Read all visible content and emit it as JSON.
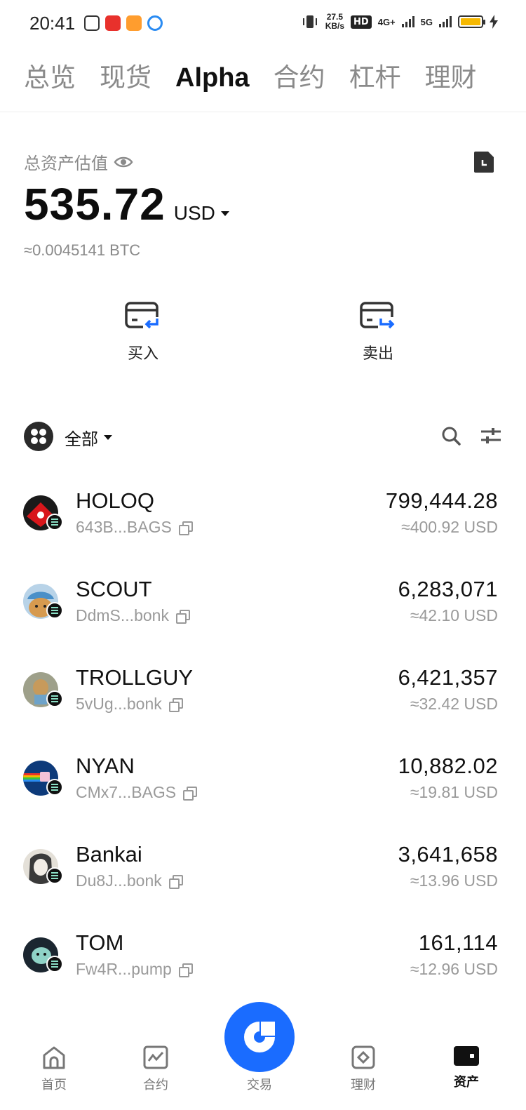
{
  "status_bar": {
    "time": "20:41",
    "net_speed_value": "27.5",
    "net_speed_unit": "KB/s",
    "hd_label": "HD",
    "sim1_label": "4G+",
    "sim2_label": "5G"
  },
  "tabs": [
    {
      "label": "总览",
      "active": false
    },
    {
      "label": "现货",
      "active": false
    },
    {
      "label": "Alpha",
      "active": true
    },
    {
      "label": "合约",
      "active": false
    },
    {
      "label": "杠杆",
      "active": false
    },
    {
      "label": "理财",
      "active": false
    }
  ],
  "overview": {
    "label": "总资产估值",
    "balance": "535.72",
    "currency": "USD",
    "btc_equivalent": "≈0.0045141 BTC"
  },
  "actions": {
    "buy_label": "买入",
    "sell_label": "卖出"
  },
  "filter": {
    "label": "全部"
  },
  "tokens": [
    {
      "symbol": "HOLOQ",
      "address": "643B...BAGS",
      "amount": "799,444.28",
      "usd": "≈400.92 USD"
    },
    {
      "symbol": "SCOUT",
      "address": "DdmS...bonk",
      "amount": "6,283,071",
      "usd": "≈42.10 USD"
    },
    {
      "symbol": "TROLLGUY",
      "address": "5vUg...bonk",
      "amount": "6,421,357",
      "usd": "≈32.42 USD"
    },
    {
      "symbol": "NYAN",
      "address": "CMx7...BAGS",
      "amount": "10,882.02",
      "usd": "≈19.81 USD"
    },
    {
      "symbol": "Bankai",
      "address": "Du8J...bonk",
      "amount": "3,641,658",
      "usd": "≈13.96 USD"
    },
    {
      "symbol": "TOM",
      "address": "Fw4R...pump",
      "amount": "161,114",
      "usd": "≈12.96 USD"
    }
  ],
  "bottom_nav": {
    "home": "首页",
    "futures": "合约",
    "trade": "交易",
    "earn": "理财",
    "assets": "资产"
  },
  "colors": {
    "accent": "#1a6cff",
    "battery": "#f6b800",
    "muted_text": "#8a8a8a"
  }
}
